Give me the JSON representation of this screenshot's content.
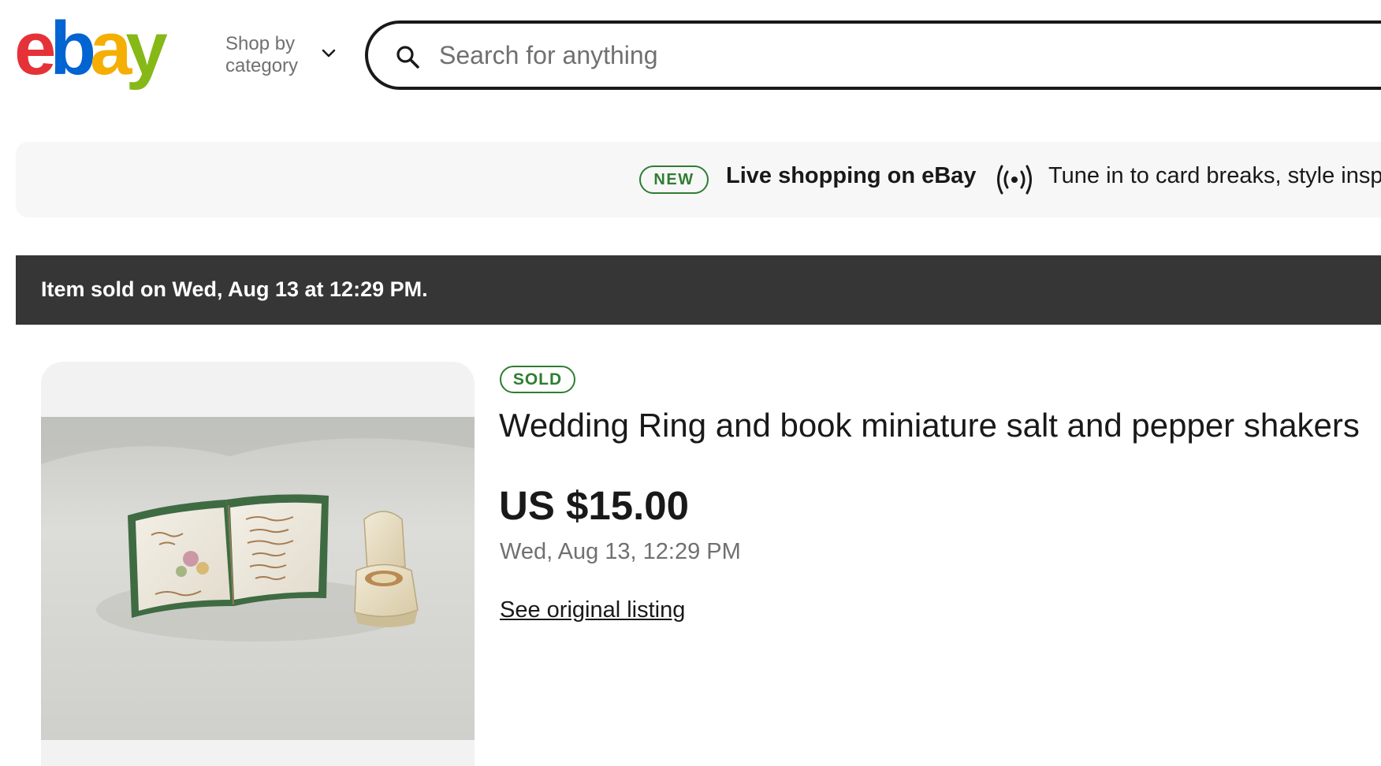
{
  "header": {
    "logo_letters": [
      "e",
      "b",
      "a",
      "y"
    ],
    "logo_colors": [
      "#e53238",
      "#0064d2",
      "#f5af02",
      "#86b817"
    ],
    "shop_by_category": "Shop by category",
    "shop_by_category_icon": "chevron-down-icon",
    "search_icon": "search-icon",
    "search_placeholder": "Search for anything"
  },
  "promo": {
    "badge": "NEW",
    "title": "Live shopping on eBay",
    "icon": "live-broadcast-icon",
    "description": "Tune in to card breaks, style inspo"
  },
  "sold_bar": {
    "message": "Item sold on Wed, Aug 13 at 12:29 PM."
  },
  "item": {
    "status_badge": "SOLD",
    "title": "Wedding Ring and book miniature salt and pepper shakers",
    "price": "US $15.00",
    "sold_date": "Wed, Aug 13, 12:29 PM",
    "original_listing_link": "See original listing",
    "image_alt": "Miniature porcelain book and wedding ring box salt and pepper shakers"
  },
  "colors": {
    "accent_green": "#2f7d32",
    "dark_bar": "#363636",
    "muted_text": "#707070",
    "banner_bg": "#f7f7f7"
  }
}
